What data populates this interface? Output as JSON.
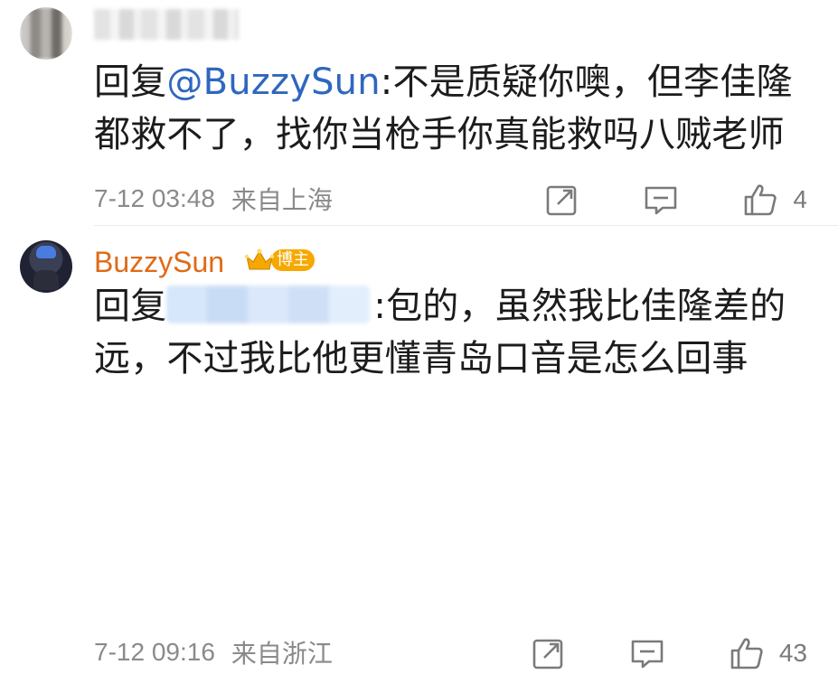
{
  "comments": [
    {
      "avatar": "blurred-avatar",
      "username": "",
      "body": {
        "reply_prefix": "回复",
        "mention": "@BuzzySun",
        "text_after_mention": ":不是质疑你噢，但李佳隆都救不了，找你当枪手你真能救吗八贼老师"
      },
      "time": "7-12 03:48",
      "location": "来自上海",
      "actions": {
        "share_icon": "share-icon",
        "comment_icon": "comment-icon",
        "like_icon": "like-icon",
        "like_count": "4"
      }
    },
    {
      "avatar": "user-avatar",
      "username": "BuzzySun",
      "badge": {
        "icon": "crown-badge-icon",
        "label": "博主"
      },
      "body": {
        "reply_prefix": "回复",
        "text_after_mention": ":包的，虽然我比佳隆差的远，不过我比他更懂青岛口音是怎么回事"
      },
      "time": "7-12 09:16",
      "location": "来自浙江",
      "actions": {
        "share_icon": "share-icon",
        "comment_icon": "comment-icon",
        "like_icon": "like-icon",
        "like_count": "43"
      }
    }
  ],
  "colors": {
    "mention": "#2f67bf",
    "username": "#e06a16",
    "badge": "#f6a800",
    "meta": "#8a8a8a"
  }
}
